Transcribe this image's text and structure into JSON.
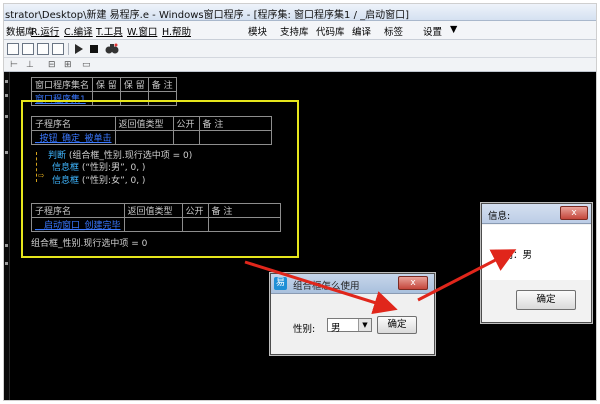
{
  "window": {
    "title": "strator\\Desktop\\新建 易程序.e - Windows窗口程序 - [程序集: 窗口程序集1 / _启动窗口]"
  },
  "menu": {
    "left": [
      "数据库",
      "R.运行",
      "C.编译",
      "T.工具",
      "W.窗口",
      "H.帮助"
    ],
    "right": [
      "模块",
      "支持库",
      "代码库",
      "编译",
      "标签",
      "设置"
    ],
    "dropdown_glyph": "▼"
  },
  "icons": {
    "run": "play-icon",
    "stop": "stop-icon",
    "find": "binoculars-icon"
  },
  "assembly_table": {
    "headers": [
      "窗口程序集名",
      "保 留",
      "保 留",
      "备 注"
    ],
    "row": [
      "窗口程序集1",
      "",
      "",
      ""
    ]
  },
  "sub1": {
    "headers": [
      "子程序名",
      "返回值类型",
      "公开",
      "备 注"
    ],
    "name": "_按钮_确定_被单击",
    "lines": [
      {
        "kw": "判断",
        "rest": " (组合框_性别.现行选中项 = 0)"
      },
      {
        "kw": "信息框",
        "rest": " (“性别:男”, 0, )"
      },
      {
        "kw": "信息框",
        "rest": " (“性别:女”, 0, )"
      }
    ]
  },
  "sub2": {
    "headers": [
      "子程序名",
      "返回值类型",
      "公开",
      "备 注"
    ],
    "name": "__启动窗口_创建完毕",
    "line": "组合框_性别.现行选中项 = 0"
  },
  "app_dialog": {
    "title": "组合框怎么使用",
    "label": "性别:",
    "combo_value": "男",
    "combo_arrow": "▼",
    "ok": "确定",
    "close": "x"
  },
  "msg_dialog": {
    "title": "信息:",
    "message": "性别：男",
    "ok": "确定",
    "close": "x"
  },
  "colors": {
    "code_background": "#000000",
    "highlight_box": "#e6e61c",
    "keyword": "#3fb6ff",
    "annotation_arrow": "#e0261b"
  }
}
